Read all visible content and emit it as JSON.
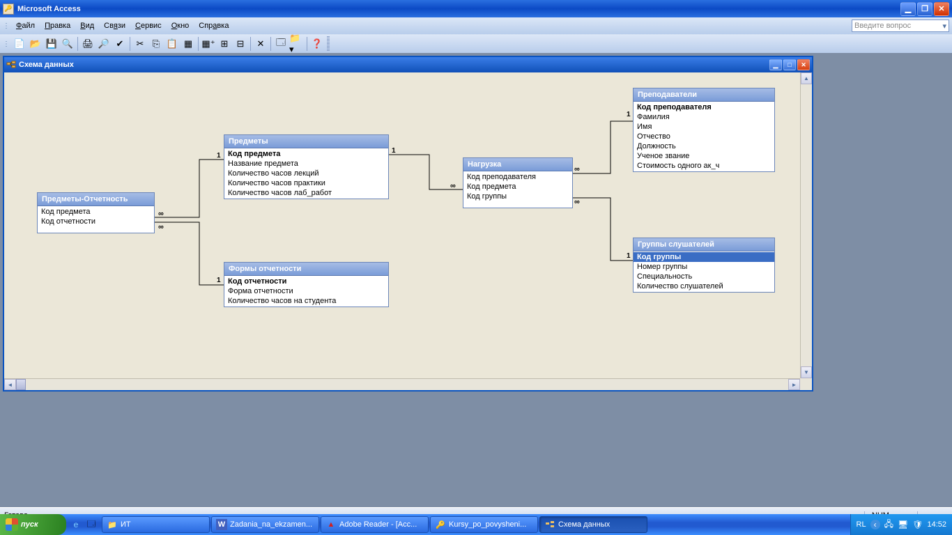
{
  "app": {
    "title": "Microsoft Access"
  },
  "menu": {
    "file": "Файл",
    "edit": "Правка",
    "view": "Вид",
    "rel": "Связи",
    "service": "Сервис",
    "window": "Окно",
    "help": "Справка",
    "ask_placeholder": "Введите вопрос"
  },
  "child": {
    "title": "Схема данных"
  },
  "tables": {
    "t1": {
      "title": "Предметы-Отчетность",
      "fields": [
        "Код предмета",
        "Код отчетности"
      ]
    },
    "t2": {
      "title": "Предметы",
      "fields": [
        "Код предмета",
        "Название предмета",
        "Количество часов лекций",
        "Количество часов практики",
        "Количество часов лаб_работ"
      ]
    },
    "t3": {
      "title": "Формы отчетности",
      "fields": [
        "Код отчетности",
        "Форма отчетности",
        "Количество часов на студента"
      ]
    },
    "t4": {
      "title": "Нагрузка",
      "fields": [
        "Код преподавателя",
        "Код предмета",
        "Код группы"
      ]
    },
    "t5": {
      "title": "Преподаватели",
      "fields": [
        "Код преподавателя",
        "Фамилия",
        "Имя",
        "Отчество",
        "Должность",
        "Ученое звание",
        "Стоимость одного ак_ч"
      ]
    },
    "t6": {
      "title": "Группы слушателей",
      "fields": [
        "Код группы",
        "Номер группы",
        "Специальность",
        "Количество слушателей"
      ]
    }
  },
  "status": {
    "ready": "Готово",
    "num": "NUM"
  },
  "taskbar": {
    "start": "пуск",
    "items": [
      "ИТ",
      "Zadania_na_ekzamen...",
      "Adobe Reader - [Acc...",
      "Kursy_po_povysheni...",
      "Схема данных"
    ],
    "lang": "RL",
    "time": "14:52"
  },
  "rel_labels": {
    "one": "1",
    "many": "∞"
  }
}
